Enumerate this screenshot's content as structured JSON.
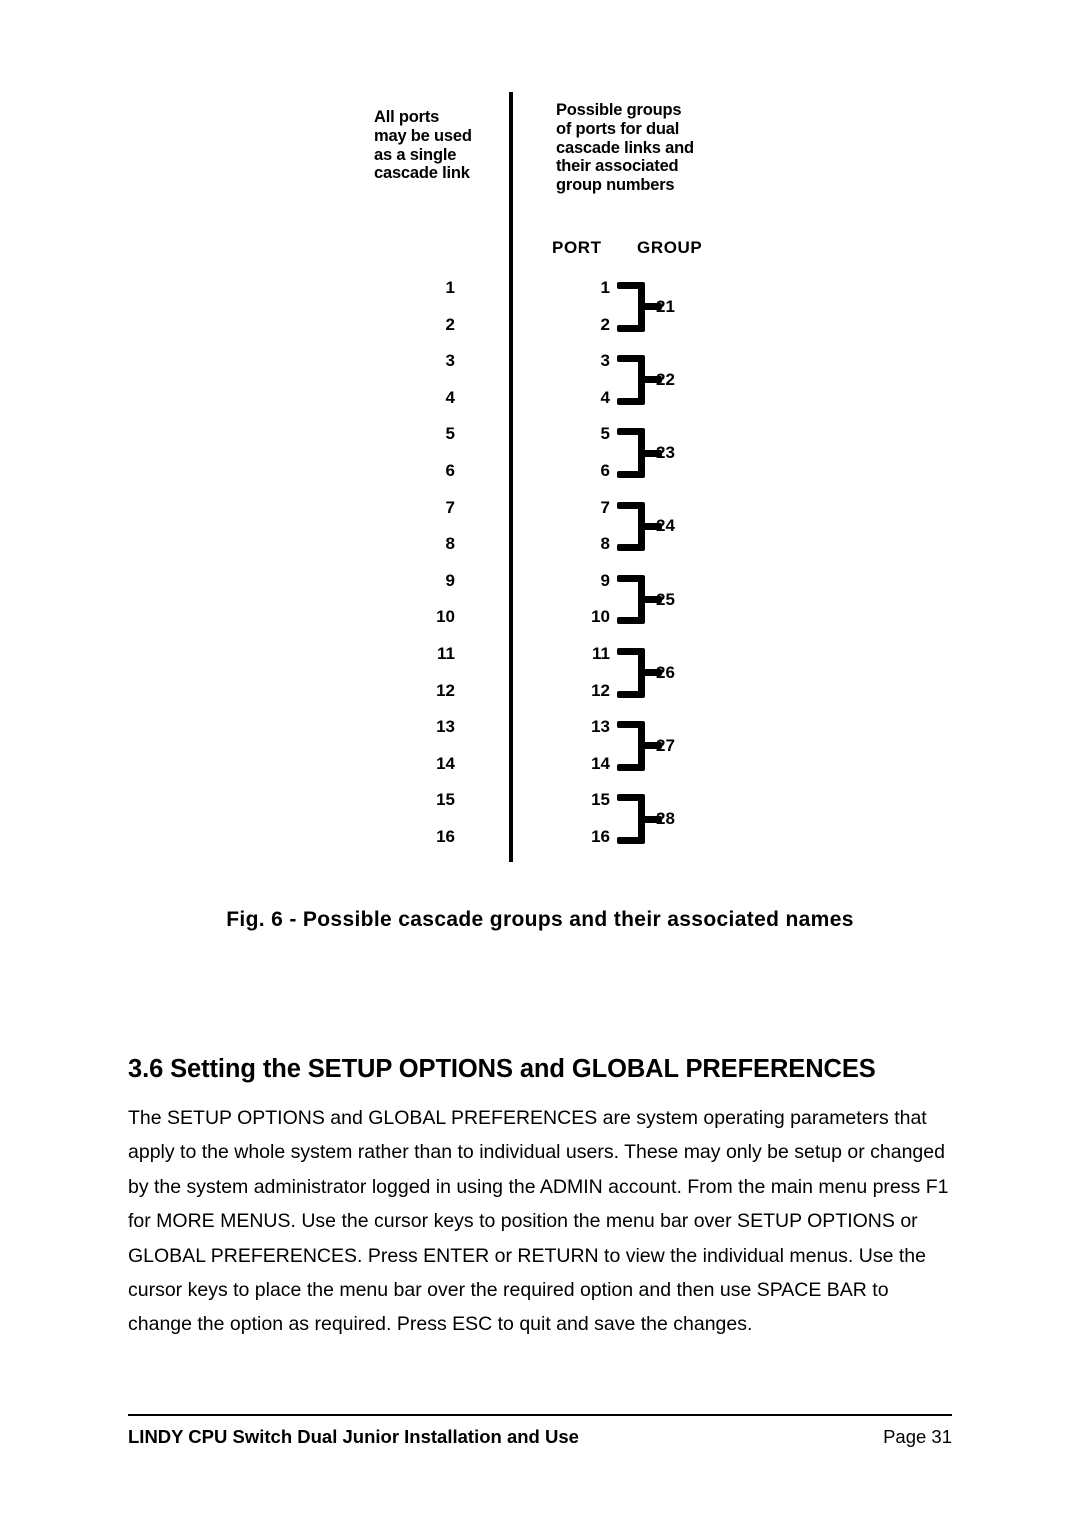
{
  "figure": {
    "left_note": "All ports\nmay be used\nas a single\ncascade link",
    "right_note": "Possible groups\nof ports for dual\ncascade links and\ntheir associated\ngroup numbers",
    "column_headers": {
      "port": "PORT",
      "group": "GROUP"
    },
    "single_link_ports": [
      "1",
      "2",
      "3",
      "4",
      "5",
      "6",
      "7",
      "8",
      "9",
      "10",
      "11",
      "12",
      "13",
      "14",
      "15",
      "16"
    ],
    "dual_link_ports": [
      "1",
      "2",
      "3",
      "4",
      "5",
      "6",
      "7",
      "8",
      "9",
      "10",
      "11",
      "12",
      "13",
      "14",
      "15",
      "16"
    ],
    "groups": [
      {
        "label": "21",
        "ports": [
          "1",
          "2"
        ]
      },
      {
        "label": "22",
        "ports": [
          "3",
          "4"
        ]
      },
      {
        "label": "23",
        "ports": [
          "5",
          "6"
        ]
      },
      {
        "label": "24",
        "ports": [
          "7",
          "8"
        ]
      },
      {
        "label": "25",
        "ports": [
          "9",
          "10"
        ]
      },
      {
        "label": "26",
        "ports": [
          "11",
          "12"
        ]
      },
      {
        "label": "27",
        "ports": [
          "13",
          "14"
        ]
      },
      {
        "label": "28",
        "ports": [
          "15",
          "16"
        ]
      }
    ],
    "caption": "Fig. 6 - Possible cascade groups and their associated names"
  },
  "section": {
    "heading": "3.6 Setting the SETUP OPTIONS and GLOBAL PREFERENCES",
    "paragraph": "The SETUP OPTIONS and GLOBAL PREFERENCES are system operating parameters that apply to the whole system rather than to individual users. These may only be setup or changed by the system administrator logged in using the ADMIN account. From the main menu press F1 for MORE MENUS. Use the cursor keys to position the menu bar over SETUP OPTIONS or GLOBAL PREFERENCES. Press ENTER or RETURN to view the individual menus. Use the cursor keys to place the menu bar over the required option and then use SPACE BAR to change the option as required. Press ESC to quit and save the changes."
  },
  "footer": {
    "title": "LINDY CPU Switch Dual Junior  Installation and Use",
    "page": "Page 31"
  },
  "colors": {
    "ink": "#000000",
    "paper": "#ffffff"
  }
}
